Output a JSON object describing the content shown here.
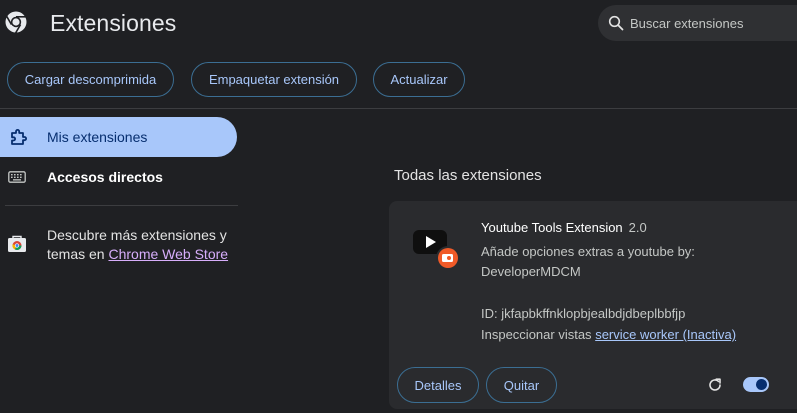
{
  "header": {
    "title": "Extensiones",
    "search": {
      "placeholder": "Buscar extensiones",
      "value": ""
    }
  },
  "toolbar": {
    "load_label": "Cargar descomprimida",
    "pack_label": "Empaquetar extensión",
    "update_label": "Actualizar"
  },
  "sidebar": {
    "items": [
      {
        "label": "Mis extensiones",
        "icon": "extension-icon",
        "active": true
      },
      {
        "label": "Accesos directos",
        "icon": "keyboard-icon",
        "active": false
      }
    ],
    "store_text": "Descubre más extensiones y temas en ",
    "store_link": "Chrome Web Store"
  },
  "main": {
    "section_title": "Todas las extensiones",
    "extension": {
      "name": "Youtube Tools Extension",
      "version": "2.0",
      "description": "Añade opciones extras a youtube by: DeveloperMDCM",
      "id_text": "ID: jkfapbkffnklopbjealbdjdbeplbbfjp",
      "inspect_label": "Inspeccionar vistas",
      "inspect_link": "service worker (Inactiva)",
      "details_label": "Detalles",
      "remove_label": "Quitar",
      "enabled": true
    }
  },
  "colors": {
    "background": "#1f2023",
    "accent": "#a8c7fa",
    "card": "#2a2b2e",
    "link": "#d7aefb"
  }
}
